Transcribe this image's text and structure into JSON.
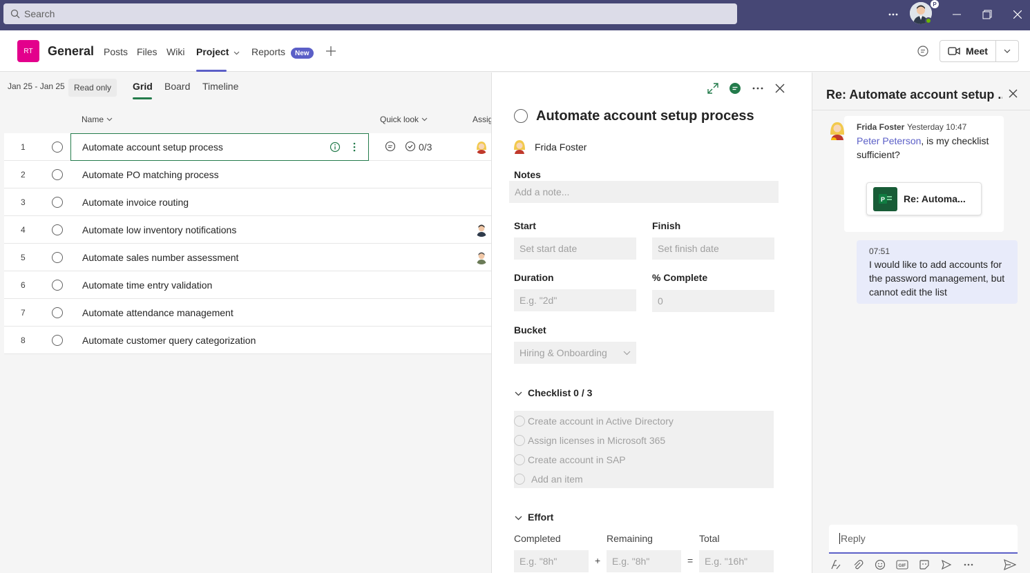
{
  "titlebar": {
    "search_placeholder": "Search",
    "avatar_badge": "P"
  },
  "channel": {
    "team_initials": "RT",
    "name": "General",
    "tabs": [
      {
        "label": "Posts"
      },
      {
        "label": "Files"
      },
      {
        "label": "Wiki"
      },
      {
        "label": "Project"
      },
      {
        "label": "Reports"
      }
    ],
    "new_badge": "New",
    "meet_label": "Meet"
  },
  "grid": {
    "date_range": "Jan 25 - Jan 25",
    "read_only": "Read only",
    "views": [
      "Grid",
      "Board",
      "Timeline"
    ],
    "columns": {
      "name": "Name",
      "quick_look": "Quick look",
      "assigned": "Assig"
    },
    "quicklook_checklist": "0/3",
    "rows": [
      {
        "num": "1",
        "name": "Automate account setup process"
      },
      {
        "num": "2",
        "name": "Automate PO matching process"
      },
      {
        "num": "3",
        "name": "Automate invoice routing"
      },
      {
        "num": "4",
        "name": "Automate low inventory notifications"
      },
      {
        "num": "5",
        "name": "Automate sales number assessment"
      },
      {
        "num": "6",
        "name": "Automate time entry validation"
      },
      {
        "num": "7",
        "name": "Automate attendance management"
      },
      {
        "num": "8",
        "name": "Automate customer query categorization"
      }
    ]
  },
  "task": {
    "title": "Automate account setup process",
    "assignee": "Frida Foster",
    "notes_label": "Notes",
    "notes_placeholder": "Add a note...",
    "start_label": "Start",
    "start_placeholder": "Set start date",
    "finish_label": "Finish",
    "finish_placeholder": "Set finish date",
    "duration_label": "Duration",
    "duration_placeholder": "E.g. \"2d\"",
    "complete_label": "% Complete",
    "complete_value": "0",
    "bucket_label": "Bucket",
    "bucket_value": "Hiring & Onboarding",
    "checklist_label": "Checklist 0 / 3",
    "checklist_items": [
      "Create account in Active Directory",
      "Assign licenses in Microsoft 365",
      "Create account in SAP"
    ],
    "add_item": "Add an item",
    "effort_label": "Effort",
    "completed_label": "Completed",
    "remaining_label": "Remaining",
    "total_label": "Total",
    "completed_placeholder": "E.g. \"8h\"",
    "remaining_placeholder": "E.g. \"8h\"",
    "total_placeholder": "E.g. \"16h\"",
    "plus": "+",
    "equals": "="
  },
  "conversation": {
    "title": "Re: Automate account setup ...",
    "msg1": {
      "author": "Frida Foster",
      "time": "Yesterday 10:47",
      "mention": "Peter Peterson",
      "text_line1_rest": ", is my checklist",
      "text_line2": "sufficient?",
      "card_title": "Re: Automa..."
    },
    "msg2": {
      "time": "07:51",
      "lines": [
        "I would like to add accounts for",
        "the password management, but",
        "cannot edit the list"
      ]
    },
    "reply_placeholder": "Reply"
  },
  "colors": {
    "titlebar": "#464775",
    "accent": "#5b5fc7",
    "planner_green": "#237b4b",
    "team_tile": "#e3008c"
  }
}
